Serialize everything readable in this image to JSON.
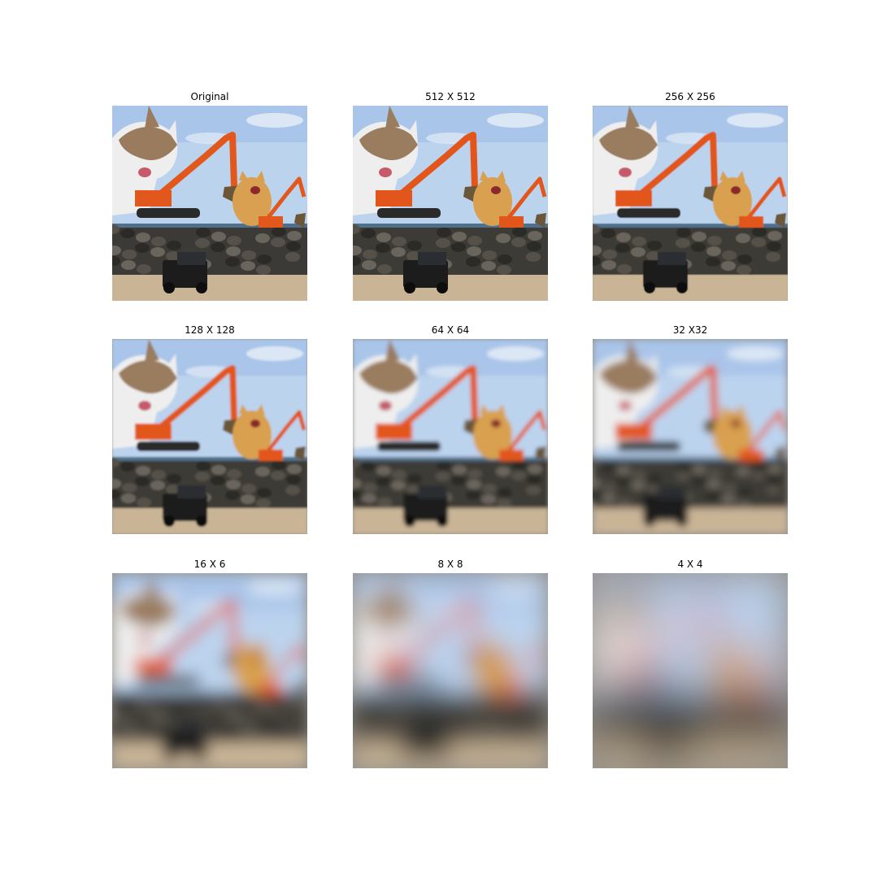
{
  "figure": {
    "panels": [
      {
        "title": "Original",
        "blur": 0
      },
      {
        "title": "512 X 512",
        "blur": 0.3
      },
      {
        "title": "256 X 256",
        "blur": 0.6
      },
      {
        "title": "128 X 128",
        "blur": 1.2
      },
      {
        "title": "64 X 64",
        "blur": 2.5
      },
      {
        "title": "32 X32",
        "blur": 4.5
      },
      {
        "title": "16 X 6",
        "blur": 9
      },
      {
        "title": "8 X 8",
        "blur": 15
      },
      {
        "title": "4 X 4",
        "blur": 26
      }
    ],
    "colors": {
      "sky": "#bcd3ee",
      "sky_top": "#9dbde6",
      "sea": "#4f6f8a",
      "excavator": "#e2571b",
      "excavator_dark": "#2a2a2a",
      "cat_white": "#eeeeee",
      "cat_tabby": "#9a7b5e",
      "cat_orange": "#d8a050",
      "rocks": "#3c3a36",
      "sand": "#c9b496",
      "car": "#1c1c1c"
    }
  }
}
